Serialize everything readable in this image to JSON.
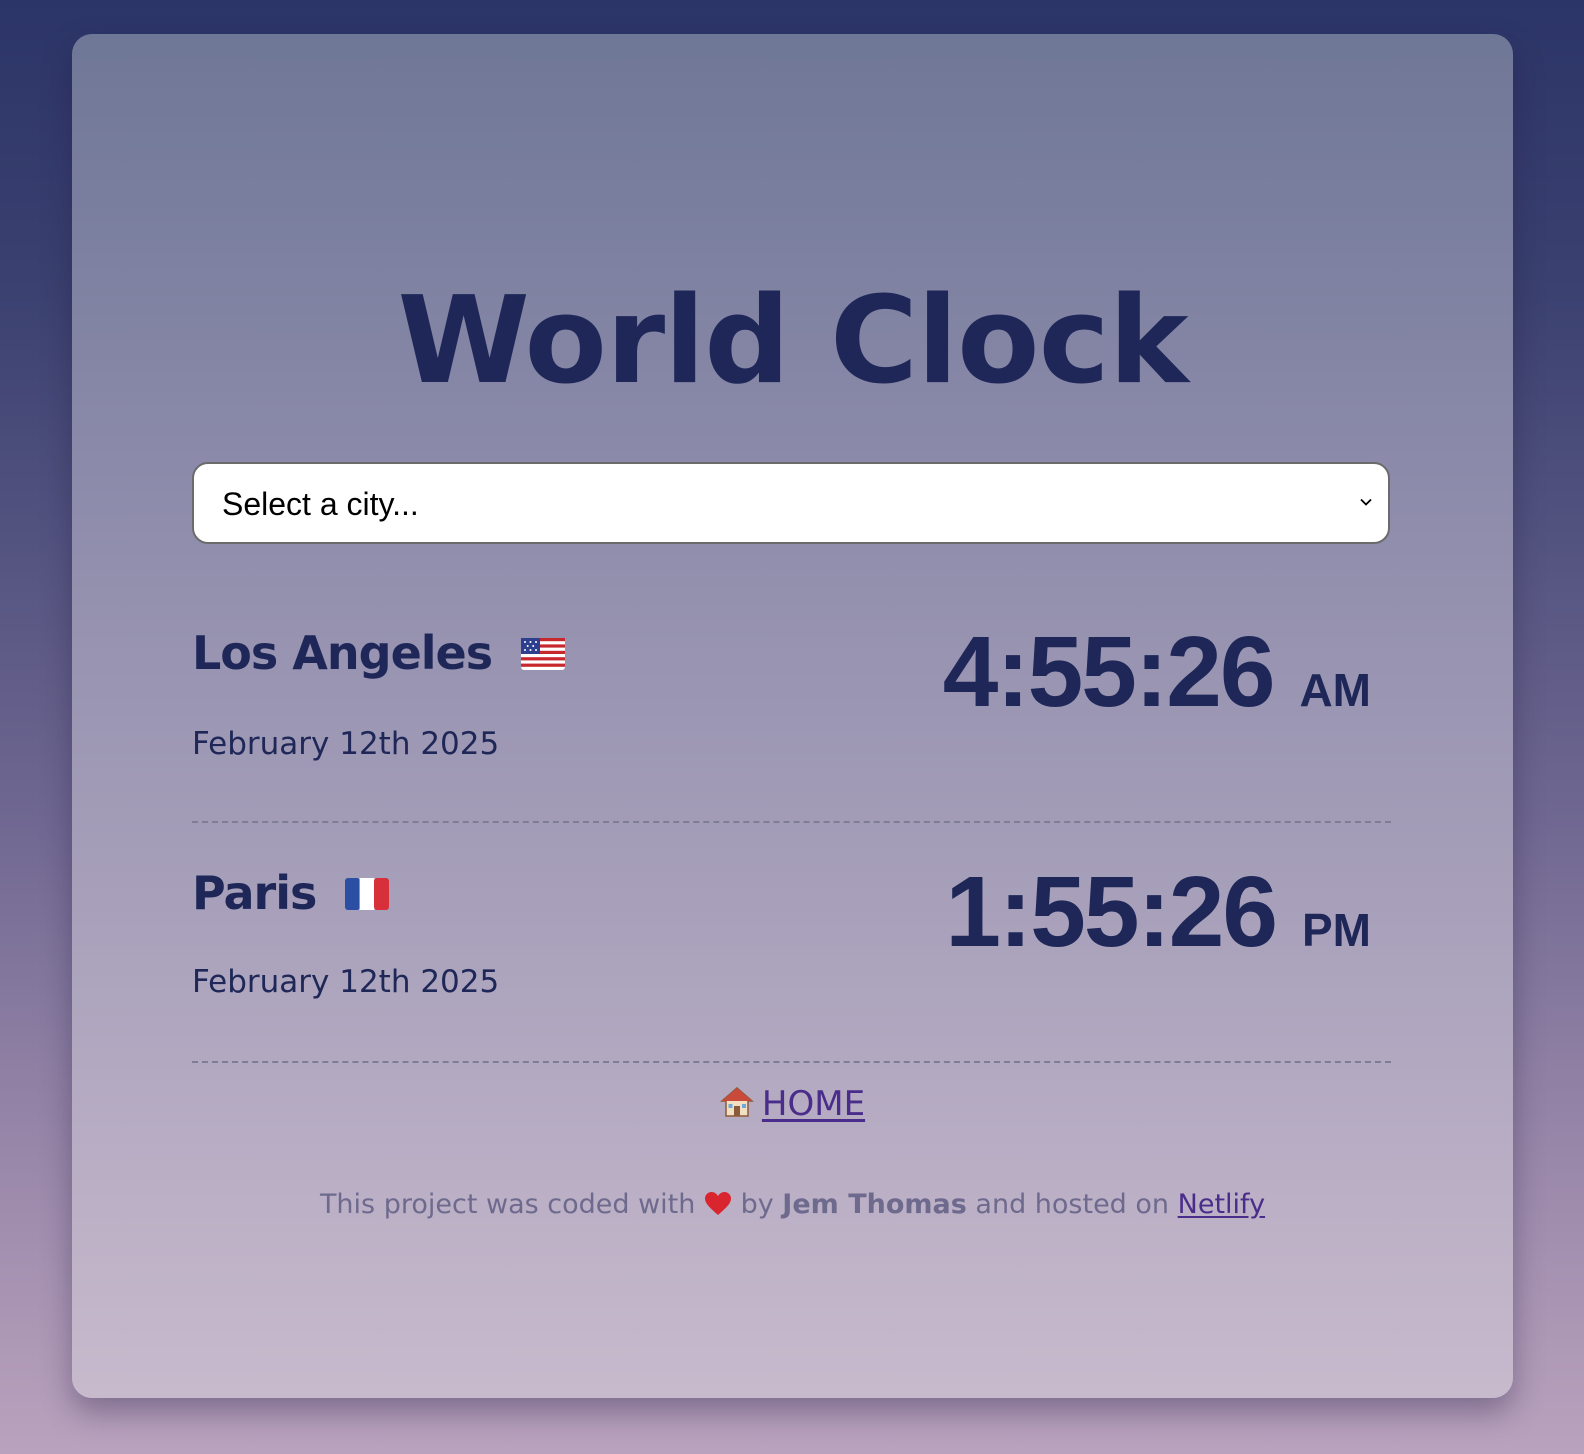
{
  "header": {
    "title": "World Clock"
  },
  "city_select": {
    "selected": "Select a city..."
  },
  "cities": [
    {
      "name": "Los Angeles",
      "flag": "us-flag",
      "date": "February 12th 2025",
      "time": "4:55:26",
      "ampm": "AM"
    },
    {
      "name": "Paris",
      "flag": "fr-flag",
      "date": "February 12th 2025",
      "time": "1:55:26",
      "ampm": "PM"
    }
  ],
  "nav": {
    "home_label": "HOME",
    "home_icon": "house-icon"
  },
  "footer": {
    "prefix": "This project was coded with",
    "heart_icon": "heart-icon",
    "by": "by",
    "author": "Jem Thomas",
    "middle": "and hosted on",
    "host_link": "Netlify"
  },
  "colors": {
    "text_primary": "#1e2757",
    "link": "#4a2c8a",
    "footer_text": "#6e6a8e",
    "page_top": "#2c3568",
    "page_bottom": "#b9a2bd"
  }
}
